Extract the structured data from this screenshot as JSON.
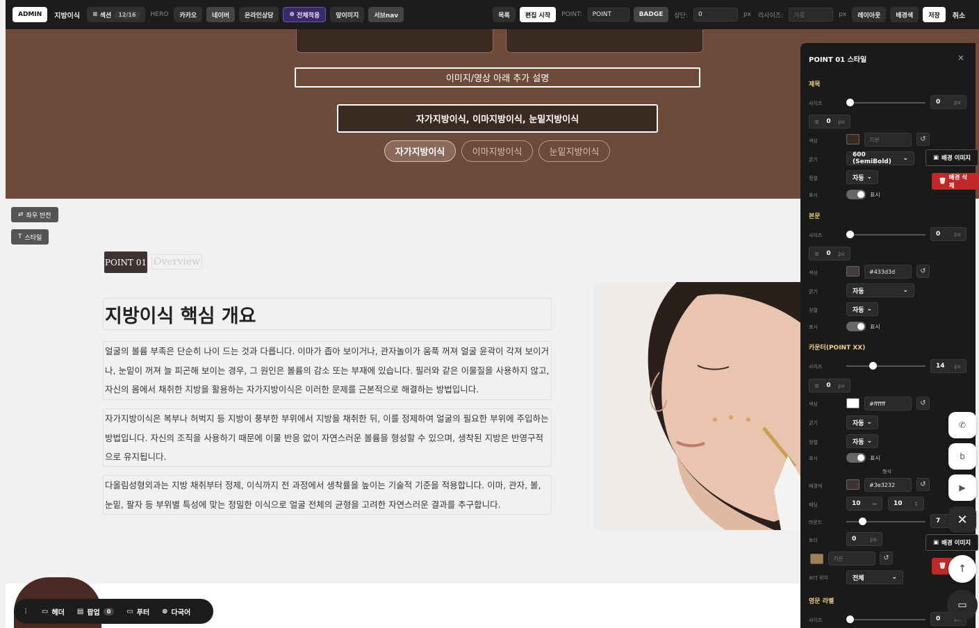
{
  "topbar": {
    "admin_label": "ADMIN",
    "page_name": "지방이식",
    "sections_label": "섹션",
    "sections_count": "12/16",
    "hero_label": "HERO",
    "kakao": "카카오",
    "naver": "네이버",
    "online": "온라인상담",
    "apply_all": "전체적용",
    "front_image": "앞이미지",
    "subnav": "서브nav",
    "list": "목록",
    "edit_start": "편집 시작",
    "point_label": "POINT:",
    "point_value": "POINT",
    "badge": "BADGE",
    "top_label": "상단:",
    "top_value": "0",
    "px1": "px",
    "resize_label": "리사이즈:",
    "resize_placeholder": "가로",
    "px2": "px",
    "layout": "레이아웃",
    "bgcolor": "배경색",
    "save": "저장",
    "cancel": "취소"
  },
  "hero": {
    "desc": "이미지/영상 아래 추가 설명",
    "title": "자가지방이식, 이마지방이식, 눈밑지방이식",
    "pills": [
      "자가지방이식",
      "이마지방이식",
      "눈밑지방이식"
    ]
  },
  "section": {
    "swap_btn": "좌우 반전",
    "style_btn": "스타일",
    "badge": "POINT 01",
    "overview": "Overview",
    "heading": "지방이식 핵심 개요",
    "paragraphs": [
      "얼굴의 볼륨 부족은 단순히 나이 드는 것과 다릅니다. 이마가 좁아 보이거나, 관자놀이가 움푹 꺼져 얼굴 윤곽이 각져 보이거나, 눈밑이 꺼져 늘 피곤해 보이는 경우, 그 원인은 볼륨의 감소 또는 부재에 있습니다. 필러와 같은 이물질을 사용하지 않고, 자신의 몸에서 채취한 지방을 활용하는 자가지방이식은 이러한 문제를 근본적으로 해결하는 방법입니다.",
      "자가지방이식은 복부나 허벅지 등 지방이 풍부한 부위에서 지방을 채취한 뒤, 이를 정제하여 얼굴의 필요한 부위에 주입하는 방법입니다. 자신의 조직을 사용하기 때문에 이물 반응 없이 자연스러운 볼륨을 형성할 수 있으며, 생착된 지방은 반영구적으로 유지됩니다.",
      "다올림성형외과는 지방 채취부터 정제, 이식까지 전 과정에서 생착률을 높이는 기술적 기준을 적용합니다. 이마, 관자, 볼, 눈밑, 팔자 등 부위별 특성에 맞는 정밀한 이식으로 얼굴 전체의 균형을 고려한 자연스러운 결과를 추구합니다."
    ]
  },
  "bottom_bar": {
    "header": "헤더",
    "popup": "팝업",
    "popup_count": "0",
    "footer": "푸터",
    "multilang": "다국어"
  },
  "panel": {
    "title": "POINT 01 스타일",
    "close": "×",
    "title_section": "제목",
    "body_section": "본문",
    "counter_section": "카운터(POINT XX)",
    "eng_section": "영문 라벨",
    "labels": {
      "size": "사이즈",
      "color": "색상",
      "weight": "굵기",
      "align": "정렬",
      "show": "표시",
      "bgcolor": "배경색",
      "padding": "패딩",
      "round": "라운드",
      "border": "보더",
      "border_pos": "보더 위치",
      "shape": "형식"
    },
    "title_style": {
      "size": "0",
      "unit": "px",
      "spacing": "0",
      "color_placeholder": "기본",
      "weight": "600 (SemiBold)",
      "align": "자동",
      "show": "표시"
    },
    "body_style": {
      "size": "0",
      "unit": "px",
      "spacing": "0",
      "color": "#433d3d",
      "weight": "자동",
      "align": "자동",
      "show": "표시"
    },
    "counter_style": {
      "size": "14",
      "unit": "px",
      "spacing": "0",
      "color": "#ffffff",
      "weight": "자동",
      "align": "자동",
      "show": "표시",
      "bgcolor": "#3e3232",
      "pad_x": "10",
      "pad_y": "10",
      "round": "7",
      "border": "0",
      "border_placeholder": "기본",
      "border_pos": "전체"
    },
    "eng_style": {
      "size": "0",
      "unit": "px"
    }
  },
  "panel_side": {
    "bg_image": "배경 이미지",
    "bg_delete": "배경 삭제",
    "bg_image2": "배경 이미지"
  },
  "colors": {
    "hero_bg": "#6e4a3a",
    "dark": "#1c1c1c",
    "badge_bg": "#3e3232",
    "accent_red": "#c0282a",
    "label_gold": "#f0d080"
  }
}
